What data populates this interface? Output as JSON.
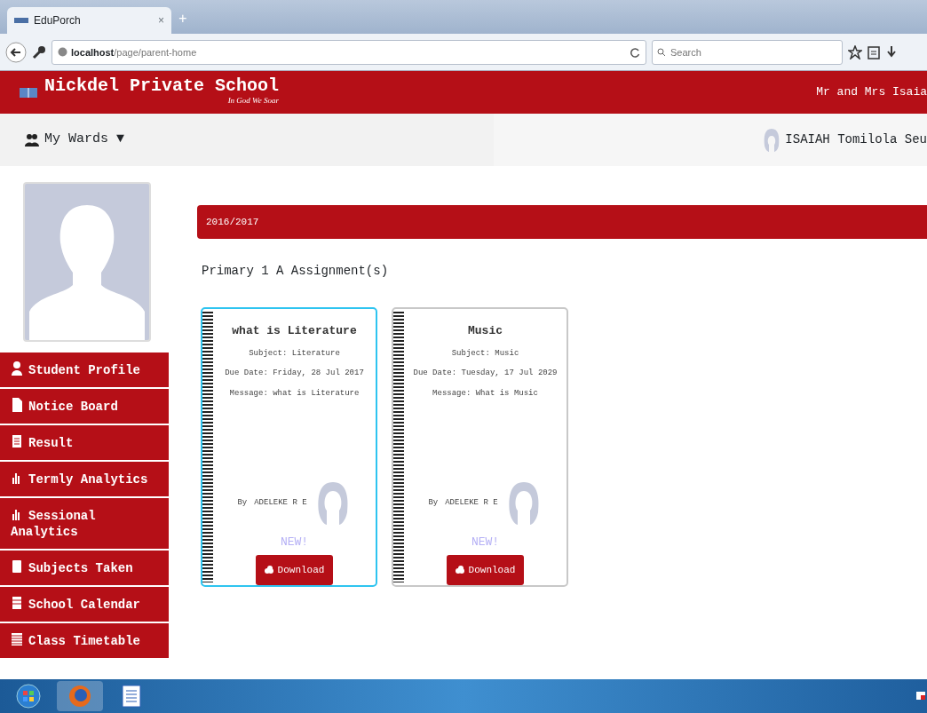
{
  "browser": {
    "tab_title": "EduPorch",
    "tab_close": "×",
    "new_tab": "+",
    "url_host": "localhost",
    "url_path": "/page/parent-home",
    "search": {
      "placeholder": "Search"
    }
  },
  "header": {
    "school_name": "Nickdel Private School",
    "motto": "In God We Soar",
    "user": "Mr and Mrs Isaia"
  },
  "subbar": {
    "wards_label": "My Wards ▼",
    "ward_name": "ISAIAH Tomilola Seu"
  },
  "sidebar": {
    "items": [
      {
        "label": "Student Profile"
      },
      {
        "label": "Notice Board"
      },
      {
        "label": "Result"
      },
      {
        "label": "Termly Analytics"
      },
      {
        "label": "Sessional Analytics"
      },
      {
        "label": "Subjects Taken"
      },
      {
        "label": "School Calendar"
      },
      {
        "label": "Class Timetable"
      }
    ]
  },
  "session": "2016/2017",
  "section_title": "Primary 1 A Assignment(s)",
  "assignments": [
    {
      "title": "what is Literature",
      "subject": "Subject: Literature",
      "due": "Due Date: Friday, 28 Jul 2017",
      "message": "Message: what is Literature",
      "by": "By",
      "teacher": "ADELEKE R E",
      "badge": "NEW!",
      "button": "Download",
      "selected": true
    },
    {
      "title": "Music",
      "subject": "Subject: Music",
      "due": "Due Date: Tuesday, 17 Jul 2029",
      "message": "Message: What is Music",
      "by": "By",
      "teacher": "ADELEKE R E",
      "badge": "NEW!",
      "button": "Download",
      "selected": false
    }
  ]
}
